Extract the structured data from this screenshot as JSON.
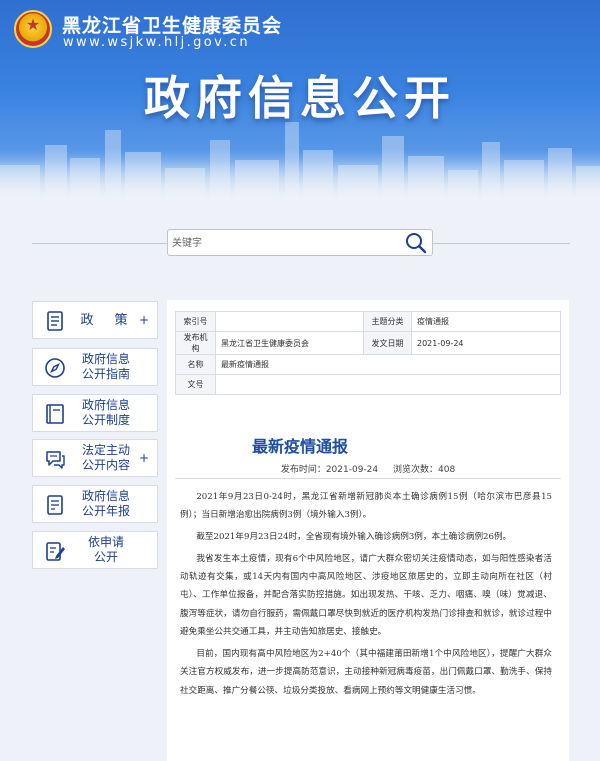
{
  "header": {
    "site_name": "黑龙江省卫生健康委员会",
    "site_url": "www.wsjkw.hlj.gov.cn",
    "banner_title": "政府信息公开"
  },
  "search": {
    "placeholder": "关键字"
  },
  "sidebar": {
    "items": [
      {
        "label": "政　策",
        "plus": "+",
        "icon": "document-list-icon"
      },
      {
        "label": "政府信息\n公开指南",
        "plus": "",
        "icon": "compass-icon"
      },
      {
        "label": "政府信息\n公开制度",
        "plus": "",
        "icon": "book-icon"
      },
      {
        "label": "法定主动\n公开内容",
        "plus": "+",
        "icon": "chat-bubbles-icon"
      },
      {
        "label": "政府信息\n公开年报",
        "plus": "",
        "icon": "report-icon"
      },
      {
        "label": "依申请\n公开",
        "plus": "",
        "icon": "edit-form-icon"
      }
    ]
  },
  "meta_table": {
    "index_label": "索引号",
    "index_value": "",
    "category_label": "主题分类",
    "category_value": "疫情通报",
    "org_label": "发布机构",
    "org_value": "黑龙江省卫生健康委员会",
    "date_label": "发文日期",
    "date_value": "2021-09-24",
    "name_label": "名称",
    "name_value": "最新疫情通报",
    "docno_label": "文号",
    "docno_value": ""
  },
  "article": {
    "title": "最新疫情通报",
    "publish_time": "发布时间：2021-09-24",
    "views": "浏览次数：408",
    "paragraphs": [
      "2021年9月23日0-24时，黑龙江省新增新冠肺炎本土确诊病例15例（哈尔滨市巴彦县15例）；当日新增治愈出院病例3例（境外输入3例）。",
      "截至2021年9月23日24时，全省现有境外输入确诊病例3例，本土确诊病例26例。",
      "我省发生本土疫情，现有6个中风险地区，请广大群众密切关注疫情动态，如与阳性感染者活动轨迹有交集，或14天内有国内中高风险地区、涉疫地区旅居史的，立即主动向所在社区（村屯）、工作单位报备，并配合落实防控措施。如出现发热、干咳、乏力、咽痛、嗅（味）觉减退、腹泻等症状，请勿自行服药，需佩戴口罩尽快到就近的医疗机构发热门诊排查和就诊，就诊过程中避免乘坐公共交通工具，并主动告知旅居史、接触史。",
      "目前，国内现有高中风险地区为2+40个（其中福建莆田新增1个中风险地区），提醒广大群众关注官方权威发布，进一步提高防范意识，主动接种新冠病毒疫苗，出门佩戴口罩、勤洗手、保持社交距离、推广分餐公筷、垃圾分类投放、看病网上预约等文明健康生活习惯。"
    ]
  },
  "colors": {
    "banner": "#3a82e0",
    "nav_text": "#1d3f8f",
    "title_blue": "#1f4fa3"
  }
}
